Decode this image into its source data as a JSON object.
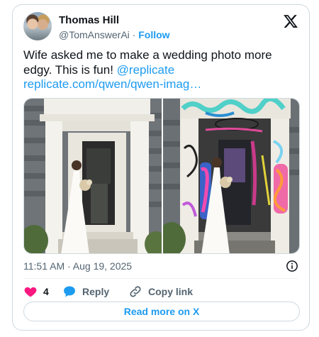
{
  "author": {
    "name": "Thomas Hill",
    "handle": "@TomAnswerAi",
    "separator": "·",
    "follow_label": "Follow"
  },
  "tweet": {
    "text_before_links": "Wife asked me to make a wedding photo more edgy. This is fun! ",
    "mention": "@replicate",
    "url_text": "replicate.com/qwen/qwen-imag…"
  },
  "media": {
    "left_image": "original-wedding-photo",
    "right_image": "graffiti-edited-wedding-photo"
  },
  "meta": {
    "timestamp": "11:51 AM · Aug 19, 2025"
  },
  "actions": {
    "like_count": "4",
    "reply_label": "Reply",
    "copy_label": "Copy link"
  },
  "read_more_label": "Read more on X",
  "colors": {
    "accent": "#1d9bf0",
    "like": "#f91880",
    "muted": "#536471",
    "text": "#0f1419",
    "border": "#cfd9de"
  },
  "icons": [
    "x-logo-icon",
    "info-icon",
    "heart-icon",
    "reply-bubble-icon",
    "link-icon"
  ]
}
